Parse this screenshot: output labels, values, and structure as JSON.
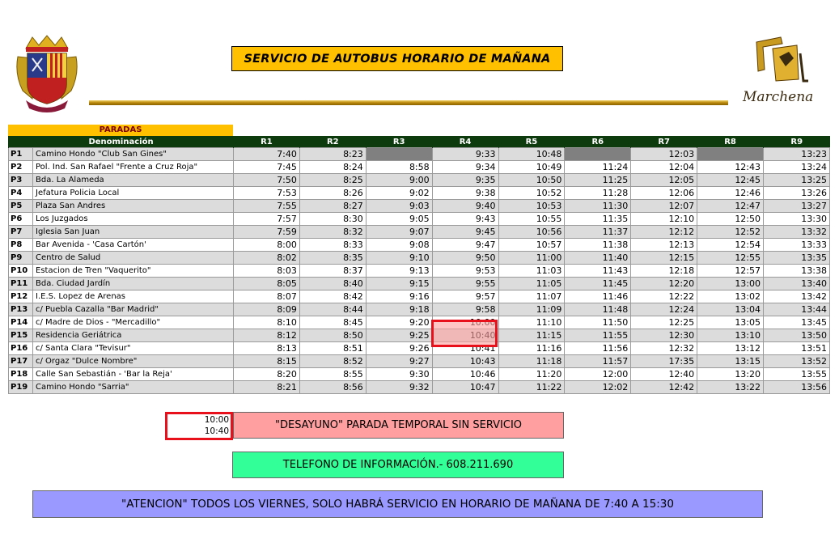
{
  "title": "SERVICIO DE AUTOBUS HORARIO DE MAÑANA",
  "logo_text": "Marchena",
  "colors": {
    "title_bg": "#ffc000",
    "header_bg": "#0d3b0d",
    "highlight_border": "#e8101a",
    "legend_bg": "#ff9f9f",
    "phone_bg": "#33ff99",
    "notice_bg": "#9999ff"
  },
  "table": {
    "group_label": "PARADAS",
    "name_header": "Denominación",
    "routes": [
      "R1",
      "R2",
      "R3",
      "R4",
      "R5",
      "R6",
      "R7",
      "R8",
      "R9"
    ],
    "rows": [
      {
        "code": "P1",
        "name": "Camino Hondo \"Club San Gines\"",
        "times": [
          "7:40",
          "8:23",
          "",
          "9:33",
          "10:48",
          "",
          "12:03",
          "",
          "13:23"
        ]
      },
      {
        "code": "P2",
        "name": "Pol. Ind. San Rafael \"Frente a Cruz Roja\"",
        "times": [
          "7:45",
          "8:24",
          "8:58",
          "9:34",
          "10:49",
          "11:24",
          "12:04",
          "12:43",
          "13:24"
        ]
      },
      {
        "code": "P3",
        "name": "Bda. La Alameda",
        "times": [
          "7:50",
          "8:25",
          "9:00",
          "9:35",
          "10:50",
          "11:25",
          "12:05",
          "12:45",
          "13:25"
        ]
      },
      {
        "code": "P4",
        "name": "Jefatura Policia Local",
        "times": [
          "7:53",
          "8:26",
          "9:02",
          "9:38",
          "10:52",
          "11:28",
          "12:06",
          "12:46",
          "13:26"
        ]
      },
      {
        "code": "P5",
        "name": "Plaza San Andres",
        "times": [
          "7:55",
          "8:27",
          "9:03",
          "9:40",
          "10:53",
          "11:30",
          "12:07",
          "12:47",
          "13:27"
        ]
      },
      {
        "code": "P6",
        "name": "Los Juzgados",
        "times": [
          "7:57",
          "8:30",
          "9:05",
          "9:43",
          "10:55",
          "11:35",
          "12:10",
          "12:50",
          "13:30"
        ]
      },
      {
        "code": "P7",
        "name": "Iglesia San Juan",
        "times": [
          "7:59",
          "8:32",
          "9:07",
          "9:45",
          "10:56",
          "11:37",
          "12:12",
          "12:52",
          "13:32"
        ]
      },
      {
        "code": "P8",
        "name": "Bar Avenida - 'Casa Cartón'",
        "times": [
          "8:00",
          "8:33",
          "9:08",
          "9:47",
          "10:57",
          "11:38",
          "12:13",
          "12:54",
          "13:33"
        ]
      },
      {
        "code": "P9",
        "name": "Centro de Salud",
        "times": [
          "8:02",
          "8:35",
          "9:10",
          "9:50",
          "11:00",
          "11:40",
          "12:15",
          "12:55",
          "13:35"
        ]
      },
      {
        "code": "P10",
        "name": "Estacion de Tren \"Vaquerito\"",
        "times": [
          "8:03",
          "8:37",
          "9:13",
          "9:53",
          "11:03",
          "11:43",
          "12:18",
          "12:57",
          "13:38"
        ]
      },
      {
        "code": "P11",
        "name": "Bda. Ciudad Jardín",
        "times": [
          "8:05",
          "8:40",
          "9:15",
          "9:55",
          "11:05",
          "11:45",
          "12:20",
          "13:00",
          "13:40"
        ]
      },
      {
        "code": "P12",
        "name": "I.E.S. Lopez de Arenas",
        "times": [
          "8:07",
          "8:42",
          "9:16",
          "9:57",
          "11:07",
          "11:46",
          "12:22",
          "13:02",
          "13:42"
        ]
      },
      {
        "code": "P13",
        "name": "c/ Puebla Cazalla \"Bar Madrid\"",
        "times": [
          "8:09",
          "8:44",
          "9:18",
          "9:58",
          "11:09",
          "11:48",
          "12:24",
          "13:04",
          "13:44"
        ]
      },
      {
        "code": "P14",
        "name": "c/ Madre de Dios - \"Mercadillo\"",
        "times": [
          "8:10",
          "8:45",
          "9:20",
          "10:00",
          "11:10",
          "11:50",
          "12:25",
          "13:05",
          "13:45"
        ]
      },
      {
        "code": "P15",
        "name": "Residencia Geriátrica",
        "times": [
          "8:12",
          "8:50",
          "9:25",
          "10:40",
          "11:15",
          "11:55",
          "12:30",
          "13:10",
          "13:50"
        ]
      },
      {
        "code": "P16",
        "name": "c/ Santa Clara \"Tevisur\"",
        "times": [
          "8:13",
          "8:51",
          "9:26",
          "10:41",
          "11:16",
          "11:56",
          "12:32",
          "13:12",
          "13:51"
        ]
      },
      {
        "code": "P17",
        "name": "c/ Orgaz \"Dulce Nombre\"",
        "times": [
          "8:15",
          "8:52",
          "9:27",
          "10:43",
          "11:18",
          "11:57",
          "17:35",
          "13:15",
          "13:52"
        ]
      },
      {
        "code": "P18",
        "name": "Calle San Sebastián - 'Bar la Reja'",
        "times": [
          "8:20",
          "8:55",
          "9:30",
          "10:46",
          "11:20",
          "12:00",
          "12:40",
          "13:20",
          "13:55"
        ]
      },
      {
        "code": "P19",
        "name": "Camino Hondo \"Sarria\"",
        "times": [
          "8:21",
          "8:56",
          "9:32",
          "10:47",
          "11:22",
          "12:02",
          "12:42",
          "13:22",
          "13:56"
        ]
      }
    ]
  },
  "legend": {
    "time_start": "10:00",
    "time_end": "10:40",
    "text": "\"DESAYUNO\" PARADA TEMPORAL SIN SERVICIO"
  },
  "phone_text": "TELEFONO DE INFORMACIÓN.- 608.211.690",
  "notice_text": "\"ATENCION\" TODOS LOS VIERNES, SOLO HABRÁ SERVICIO EN HORARIO DE MAÑANA DE 7:40 A 15:30"
}
